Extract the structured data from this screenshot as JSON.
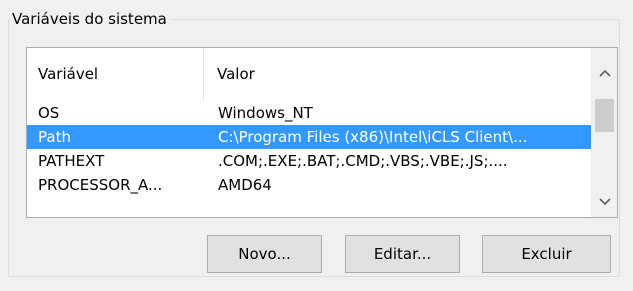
{
  "group": {
    "title": "Variáveis do sistema"
  },
  "table": {
    "columns": [
      "Variável",
      "Valor"
    ],
    "rows": [
      {
        "variable": "OS",
        "value": "Windows_NT",
        "selected": false
      },
      {
        "variable": "Path",
        "value": "C:\\Program Files (x86)\\Intel\\iCLS Client\\...",
        "selected": true
      },
      {
        "variable": "PATHEXT",
        "value": ".COM;.EXE;.BAT;.CMD;.VBS;.VBE;.JS;....",
        "selected": false
      },
      {
        "variable": "PROCESSOR_A...",
        "value": "AMD64",
        "selected": false
      }
    ]
  },
  "scrollbar": {
    "up_icon": "chevron-up-icon",
    "down_icon": "chevron-down-icon"
  },
  "buttons": {
    "new_label": "Novo...",
    "edit_label": "Editar...",
    "delete_label": "Excluir"
  },
  "colors": {
    "selection": "#3399ff",
    "window_bg": "#f0f0f0"
  }
}
